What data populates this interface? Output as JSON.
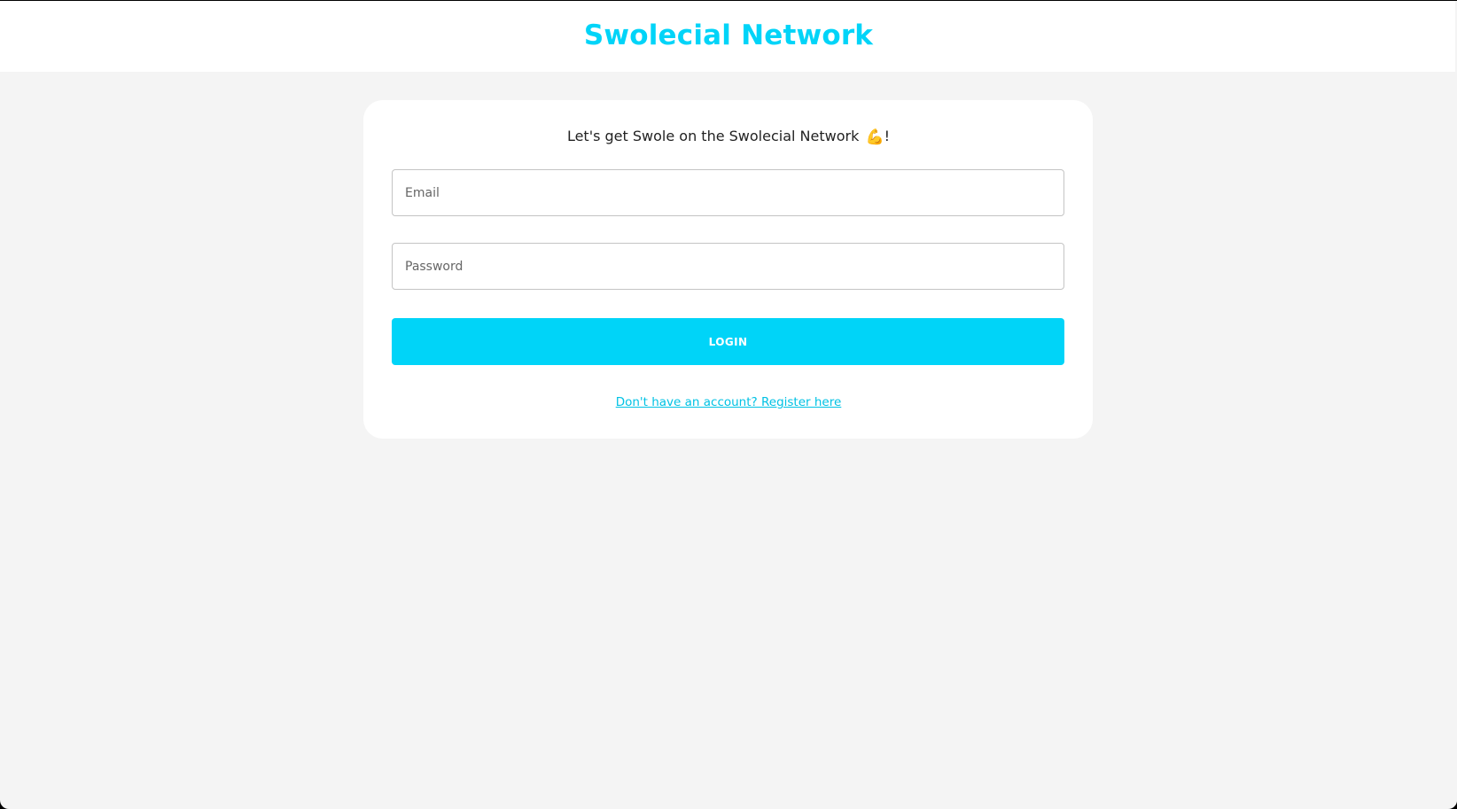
{
  "header": {
    "title": "Swolecial Network"
  },
  "login_card": {
    "heading": "Let's get Swole on the Swolecial Network",
    "heading_emoji": "💪",
    "heading_suffix": "!",
    "email": {
      "placeholder": "Email",
      "value": ""
    },
    "password": {
      "placeholder": "Password",
      "value": ""
    },
    "login_label": "LOGIN",
    "register_link": "Don't have an account? Register here"
  },
  "colors": {
    "brand": "#00d4f8",
    "page_background": "#f4f4f4",
    "card_background": "#ffffff",
    "heading_text": "#222222",
    "link": "#00c2e4"
  },
  "icons": {
    "heading_emoji": "flexed-biceps-icon"
  }
}
